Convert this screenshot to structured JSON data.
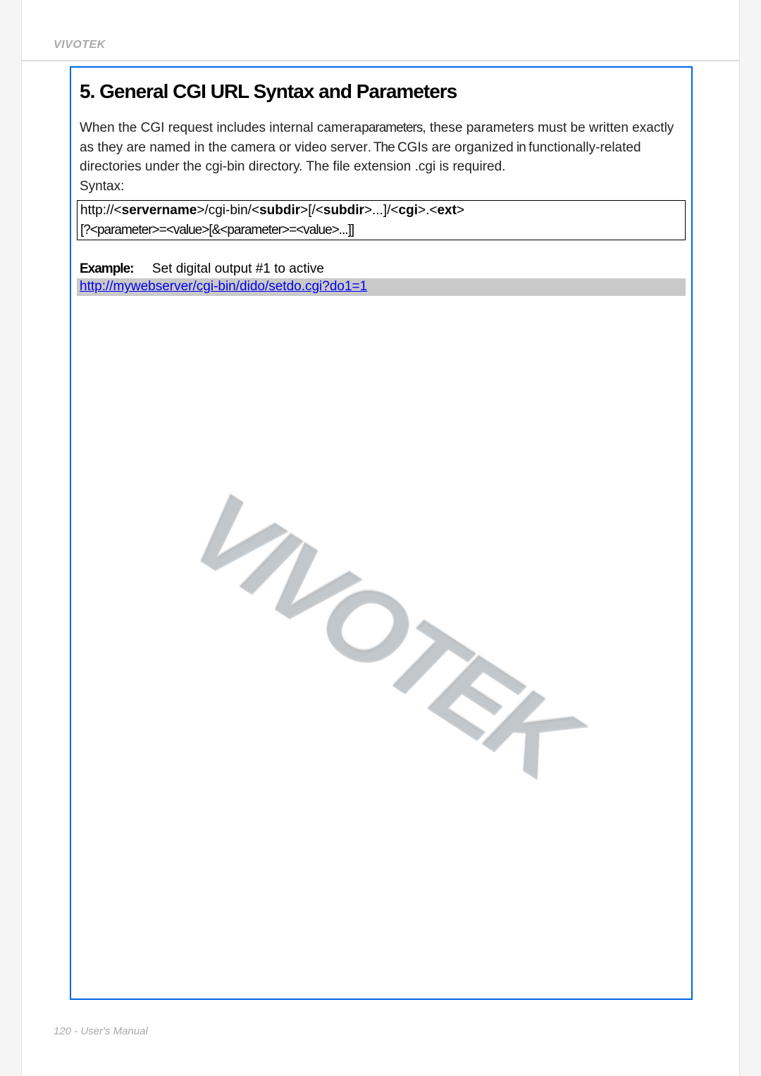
{
  "header": {
    "brand": "VIVOTEK"
  },
  "section": {
    "heading": "5. General CGI URL Syntax and Parameters",
    "para1a": "When the CGI request includes internal camera",
    "para1b": "parameters",
    "para1c": ", these parameters must be written exactly",
    "para2a": "as they are named in the camera or video server",
    "para2b": ". The ",
    "para2c": "CGIs are organized",
    "para2d": " in ",
    "para2e": "functionally-related",
    "para3": "directories under the cgi-bin directory. The file extension .cgi is required.",
    "syntax_label": "Syntax:"
  },
  "syntax": {
    "line1_a": "http://<",
    "line1_b": "servername",
    "line1_c": ">/cgi-bin/<",
    "line1_d": "subdir",
    "line1_e": ">[/<",
    "line1_f": "subdir",
    "line1_g": ">...]/<",
    "line1_h": "cgi",
    "line1_i": ">.<",
    "line1_j": "ext",
    "line1_k": ">",
    "line2": "[?<parameter>=<value>[&<parameter>=<value>...]]"
  },
  "example": {
    "label_prefix": "Example:",
    "label_text": "Set digital output #1 to active",
    "link_text": "http://mywebserver/cgi-bin/dido/setdo.cgi?do1=1",
    "link_suffix": ""
  },
  "watermark": "VIVOTEK",
  "footer": {
    "page": "120",
    "sep": " - ",
    "title": "User's Manual"
  }
}
